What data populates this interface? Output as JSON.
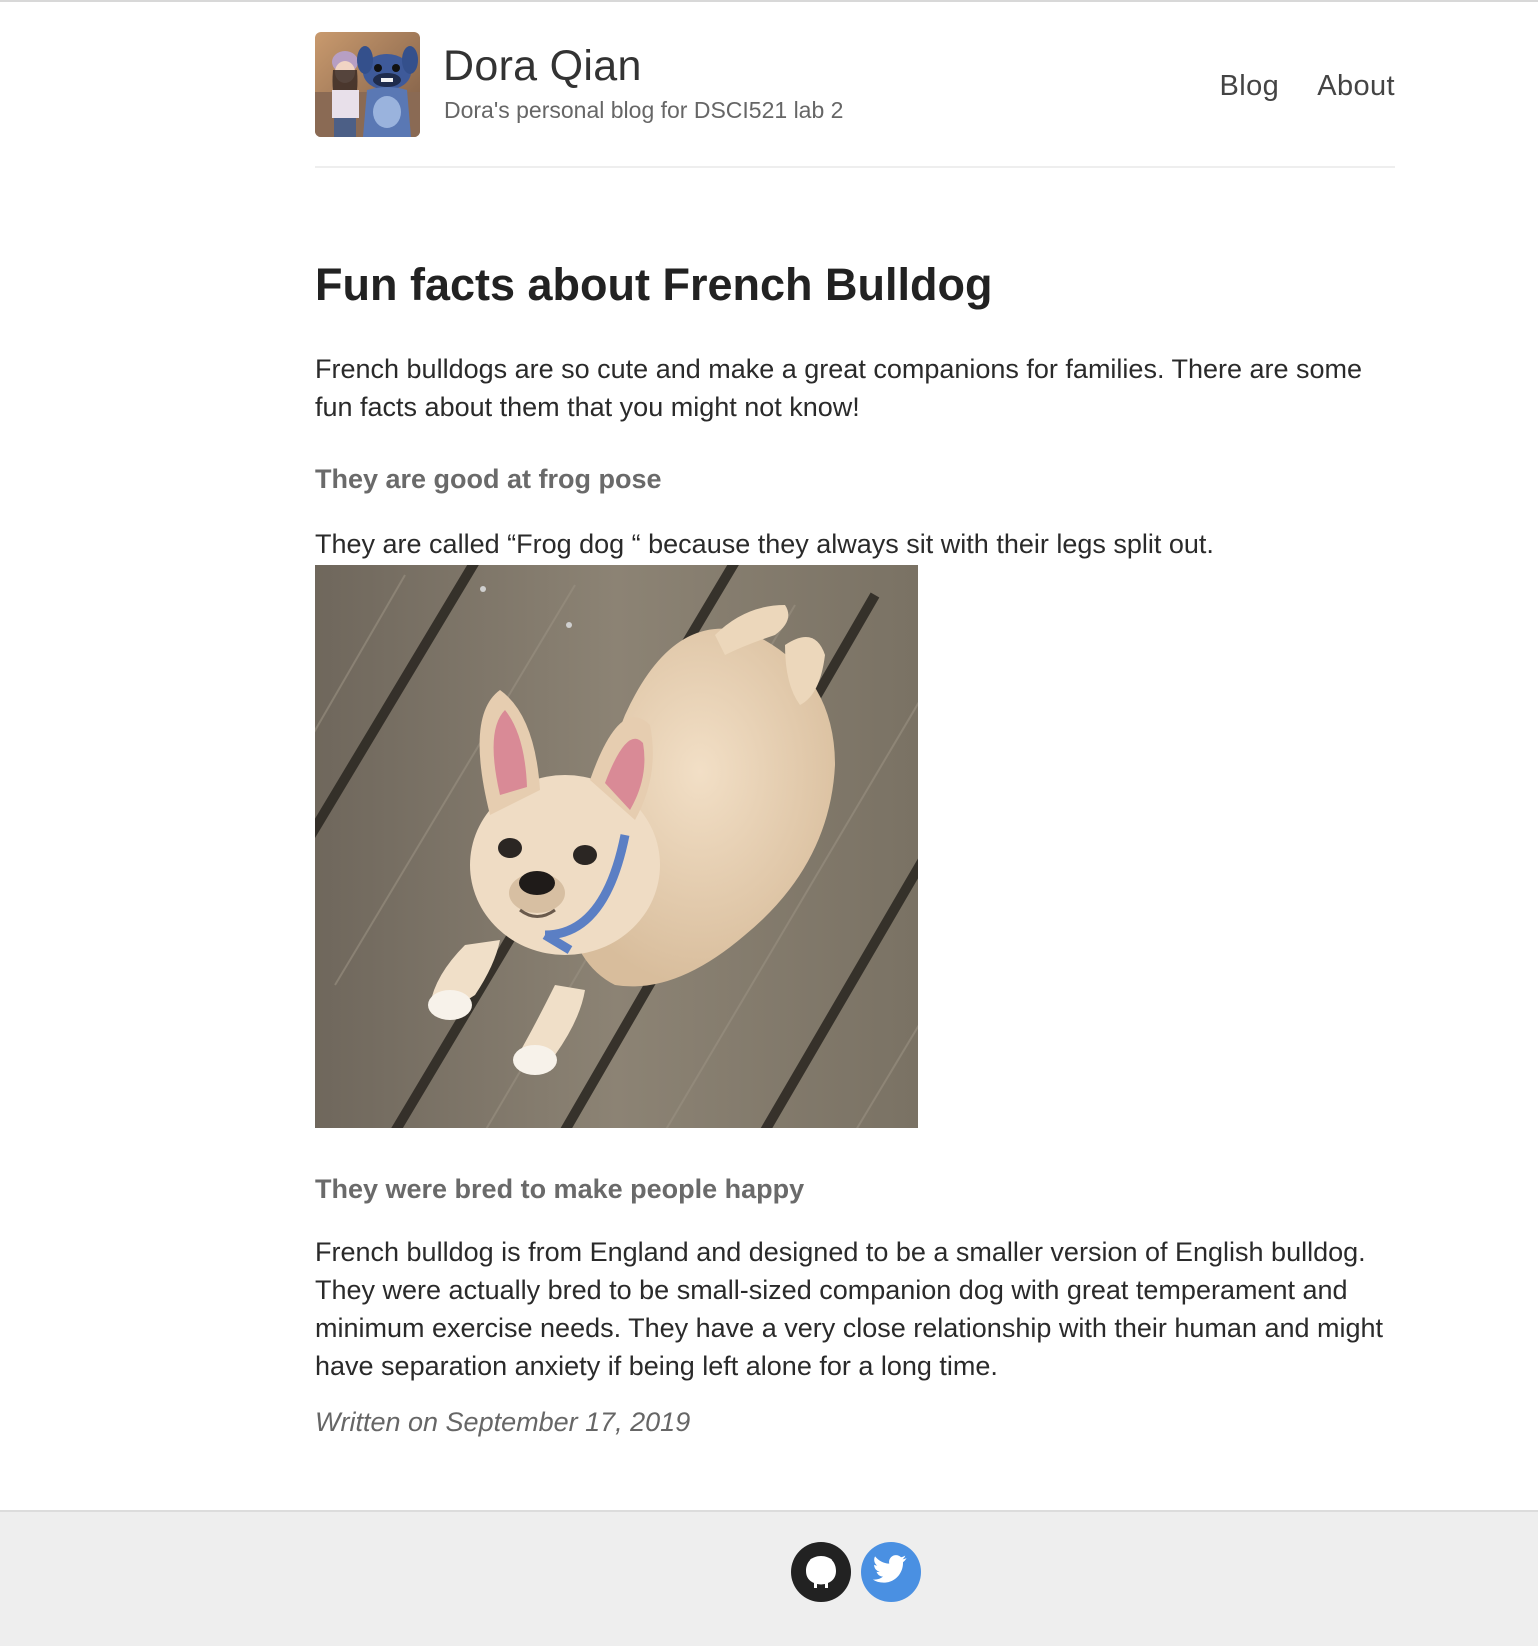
{
  "site": {
    "name": "Dora Qian",
    "description": "Dora's personal blog for DSCI521 lab 2"
  },
  "nav": {
    "blog_label": "Blog",
    "about_label": "About"
  },
  "post": {
    "title": "Fun facts about French Bulldog",
    "intro": "French bulldogs are so cute and make a great companions for families. There are some fun facts about them that you might not know!",
    "sections": [
      {
        "heading": "They are good at frog pose",
        "text": "They are called “Frog dog “ because they always sit with their legs split out."
      },
      {
        "heading": "They were bred to make people happy",
        "text": "French bulldog is from England and designed to be a smaller version of English bulldog. They were actually bred to be small-sized companion dog with great temperament and minimum exercise needs. They have a very close relationship with their human and might have separation anxiety if being left alone for a long time."
      }
    ],
    "date": "Written on September 17, 2019"
  },
  "footer": {
    "icons": [
      "github-icon",
      "twitter-icon"
    ]
  },
  "colors": {
    "twitter": "#4a90e2",
    "github": "#222222",
    "footer_bg": "#eeeeee"
  }
}
